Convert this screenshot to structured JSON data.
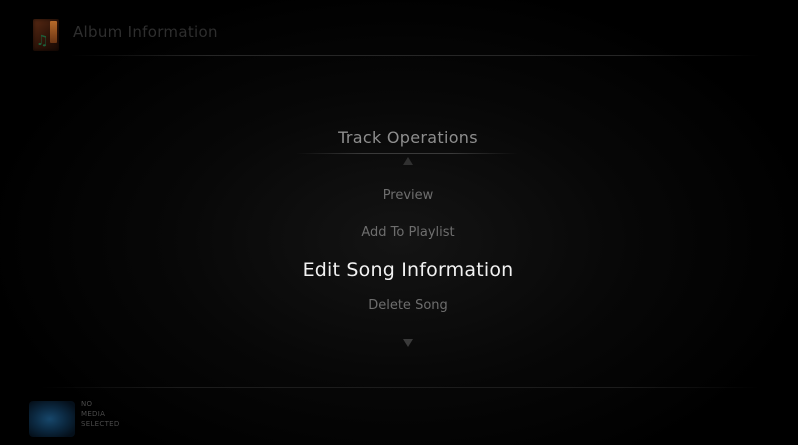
{
  "header": {
    "title": "Album Information",
    "icon": "album-art-music-note-icon"
  },
  "menu": {
    "title": "Track Operations",
    "scroll_up_icon": "arrow-up-icon",
    "scroll_down_icon": "arrow-down-icon",
    "items": [
      {
        "label": "Preview",
        "selected": false
      },
      {
        "label": "Add To Playlist",
        "selected": false
      },
      {
        "label": "Edit Song Information",
        "selected": true
      },
      {
        "label": "Delete Song",
        "selected": false
      }
    ]
  },
  "footer": {
    "status_lines": [
      "NO",
      "MEDIA",
      "SELECTED"
    ],
    "thumbnail_icon": "media-thumbnail-icon"
  },
  "colors": {
    "background": "#000000",
    "selected_text": "#f2f2f2",
    "dim_text": "#6e6e6e",
    "title_text": "#8e8e8e"
  }
}
